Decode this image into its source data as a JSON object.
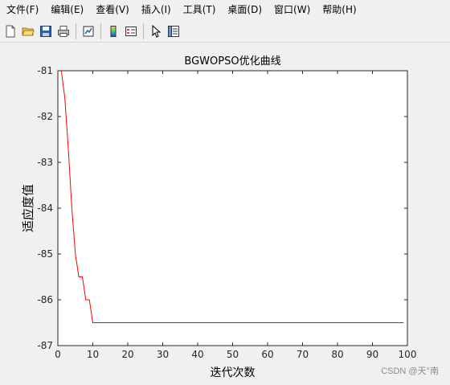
{
  "menu": [
    {
      "label": "文件(F)"
    },
    {
      "label": "编辑(E)"
    },
    {
      "label": "查看(V)"
    },
    {
      "label": "插入(I)"
    },
    {
      "label": "工具(T)"
    },
    {
      "label": "桌面(D)"
    },
    {
      "label": "窗口(W)"
    },
    {
      "label": "帮助(H)"
    }
  ],
  "toolbar": [
    {
      "icon": "new-file-icon"
    },
    {
      "icon": "open-folder-icon"
    },
    {
      "icon": "save-icon"
    },
    {
      "icon": "print-icon"
    },
    {
      "icon": "link-plot-icon"
    },
    {
      "icon": "insert-colorbar-icon"
    },
    {
      "icon": "insert-legend-icon"
    },
    {
      "icon": "pointer-icon"
    },
    {
      "icon": "property-editor-icon"
    }
  ],
  "watermark": "CSDN @天°南",
  "chart_data": {
    "type": "line",
    "title": "BGWOPSO优化曲线",
    "xlabel": "迭代次数",
    "ylabel": "适应度值",
    "xlim": [
      0,
      100
    ],
    "ylim": [
      -87,
      -81
    ],
    "xticks": [
      0,
      10,
      20,
      30,
      40,
      50,
      60,
      70,
      80,
      90,
      100
    ],
    "yticks": [
      -81,
      -82,
      -83,
      -84,
      -85,
      -86,
      -87
    ],
    "grid": false,
    "series": [
      {
        "color": "#ff0000",
        "x": [
          1,
          2,
          3,
          4,
          5,
          6,
          7,
          8,
          9,
          10,
          11,
          99
        ],
        "y": [
          -81.0,
          -81.6,
          -82.7,
          -84.0,
          -85.0,
          -85.5,
          -85.5,
          -86.0,
          -86.0,
          -86.5,
          -86.5,
          -86.5
        ]
      }
    ]
  }
}
